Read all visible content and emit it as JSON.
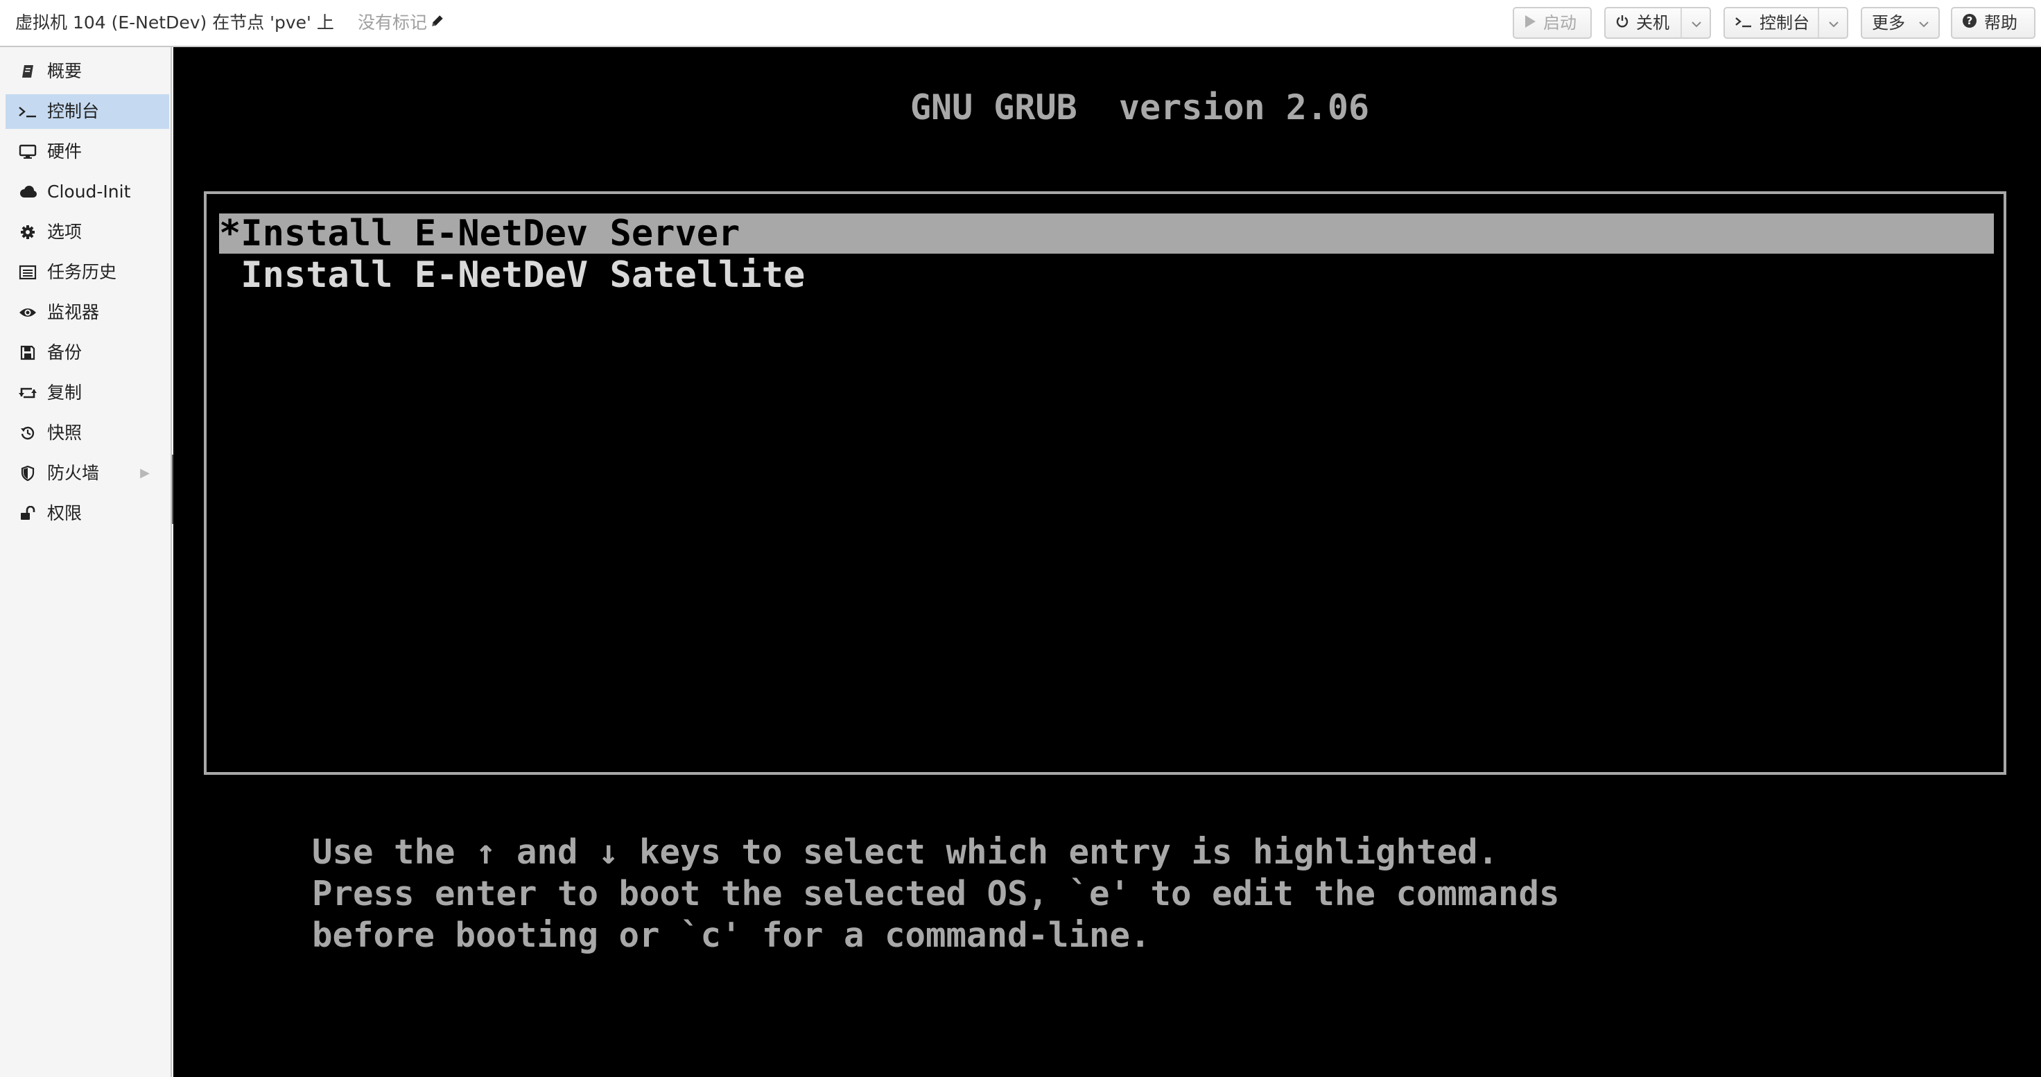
{
  "header": {
    "vm_title": "虚拟机 104 (E-NetDev) 在节点 'pve' 上",
    "tags_label": "没有标记",
    "buttons": {
      "start": "启动",
      "shutdown": "关机",
      "console": "控制台",
      "more": "更多",
      "help": "帮助"
    }
  },
  "sidebar": {
    "items": [
      {
        "label": "概要",
        "icon": "book-icon"
      },
      {
        "label": "控制台",
        "icon": "terminal-icon",
        "active": true
      },
      {
        "label": "硬件",
        "icon": "desktop-icon"
      },
      {
        "label": "Cloud-Init",
        "icon": "cloud-icon"
      },
      {
        "label": "选项",
        "icon": "gear-icon"
      },
      {
        "label": "任务历史",
        "icon": "list-icon"
      },
      {
        "label": "监视器",
        "icon": "eye-icon"
      },
      {
        "label": "备份",
        "icon": "floppy-icon"
      },
      {
        "label": "复制",
        "icon": "retweet-icon"
      },
      {
        "label": "快照",
        "icon": "history-icon"
      },
      {
        "label": "防火墙",
        "icon": "shield-icon"
      },
      {
        "label": "权限",
        "icon": "unlock-icon"
      }
    ]
  },
  "console": {
    "grub_title": "GNU GRUB  version 2.06",
    "menu_entries": [
      "*Install E-NetDev Server",
      " Install E-NetDeV Satellite"
    ],
    "selected_index": 0,
    "help_lines": [
      "Use the ↑ and ↓ keys to select which entry is highlighted.",
      "Press enter to boot the selected OS, `e' to edit the commands",
      "before booting or `c' for a command-line."
    ]
  },
  "colors": {
    "accent_active": "#c5daf1",
    "console_bg": "#000000",
    "grub_text": "#a8a8a8"
  }
}
